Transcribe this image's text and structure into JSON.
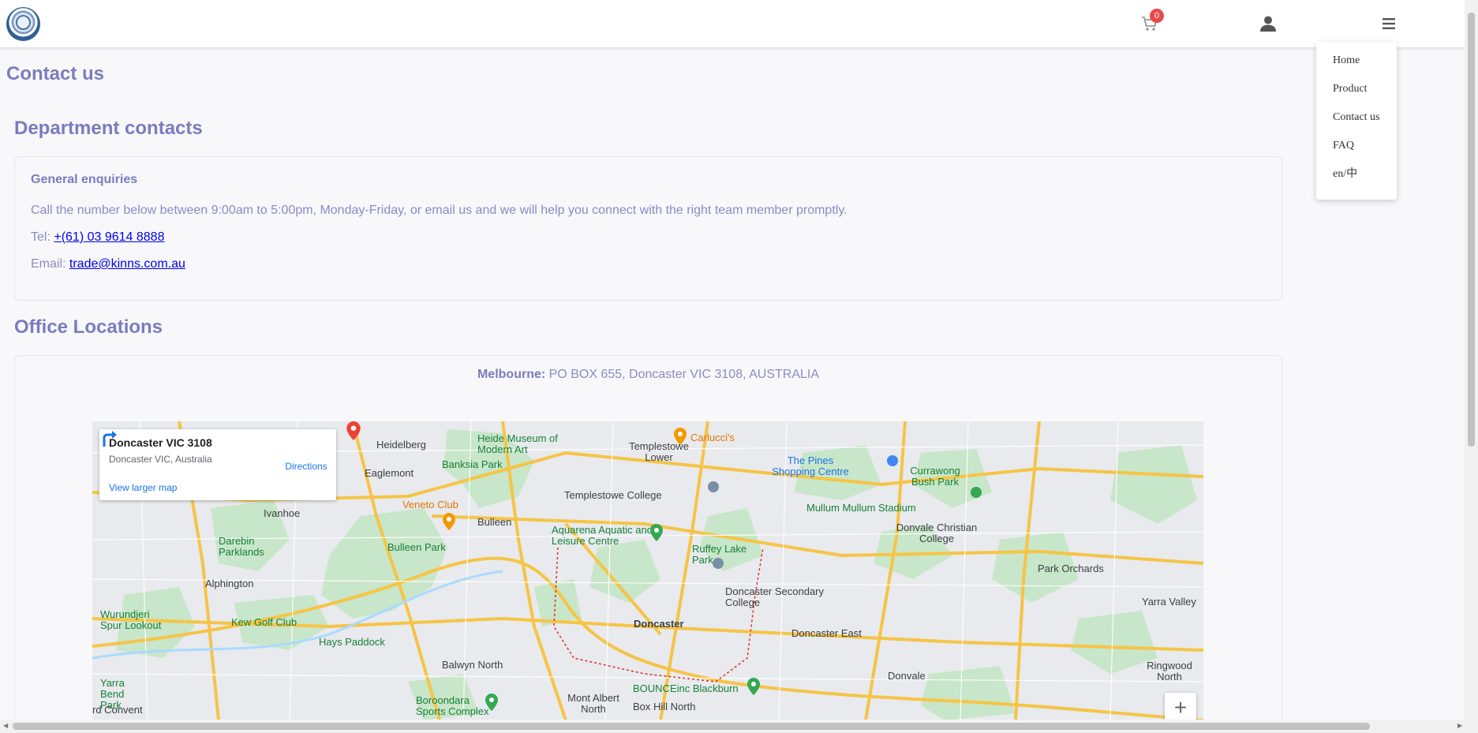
{
  "header": {
    "cart_count": "0"
  },
  "menu": {
    "items": [
      "Home",
      "Product",
      "Contact us",
      "FAQ",
      "en/中"
    ]
  },
  "page": {
    "title": "Contact us"
  },
  "department": {
    "title": "Department contacts",
    "heading": "General enquiries",
    "description": "Call the number below between 9:00am to 5:00pm, Monday-Friday, or email us and we will help you connect with the right team member promptly.",
    "tel_label": "Tel: ",
    "tel": "+(61) 03 9614 8888",
    "email_label": "Email: ",
    "email": "trade@kinns.com.au"
  },
  "office": {
    "title": "Office Locations",
    "city": "Melbourne:",
    "address": " PO BOX 655, Doncaster VIC 3108, AUSTRALIA"
  },
  "map": {
    "info_title": "Doncaster VIC 3108",
    "info_subtitle": "Doncaster VIC, Australia",
    "directions": "Directions",
    "larger_map": "View larger map",
    "zoom_in": "+",
    "labels": {
      "heidelberg": "Heidelberg",
      "eaglemont": "Eaglemont",
      "ivanhoe": "Ivanhoe",
      "darebin": "Darebin Parklands",
      "alphington": "Alphington",
      "wurundjeri": "Wurundjeri Spur Lookout",
      "yarra_bend": "Yarra Bend Park",
      "kew_golf": "Kew Golf Club",
      "hays": "Hays Paddock",
      "heide": "Heide Museum of Modern Art",
      "banksia": "Banksia Park",
      "veneto": "Veneto Club",
      "bulleen": "Bulleen",
      "bulleen_park": "Bulleen Park",
      "templestowe_lower": "Templestowe Lower",
      "templestowe_college": "Templestowe College",
      "aquarena": "Aquarena Aquatic and Leisure Centre",
      "carluccis": "Carlucci's",
      "ruffey": "Ruffey Lake Park",
      "doncaster_secondary": "Doncaster Secondary College",
      "doncaster": "Doncaster",
      "doncaster_east": "Doncaster East",
      "pines": "The Pines Shopping Centre",
      "currawong": "Currawong Bush Park",
      "mullum": "Mullum Mullum Stadium",
      "donvale_christian": "Donvale Christian College",
      "park_orchards": "Park Orchards",
      "yarra_valley": "Yarra Valley",
      "donvale": "Donvale",
      "ringwood_north": "Ringwood North",
      "balwyn_north": "Balwyn North",
      "boroondara": "Boroondara Sports Complex",
      "mont_albert": "Mont Albert North",
      "box_hill_north": "Box Hill North",
      "bounce": "BOUNCEinc Blackburn",
      "red_convent": "rd Convent"
    }
  }
}
